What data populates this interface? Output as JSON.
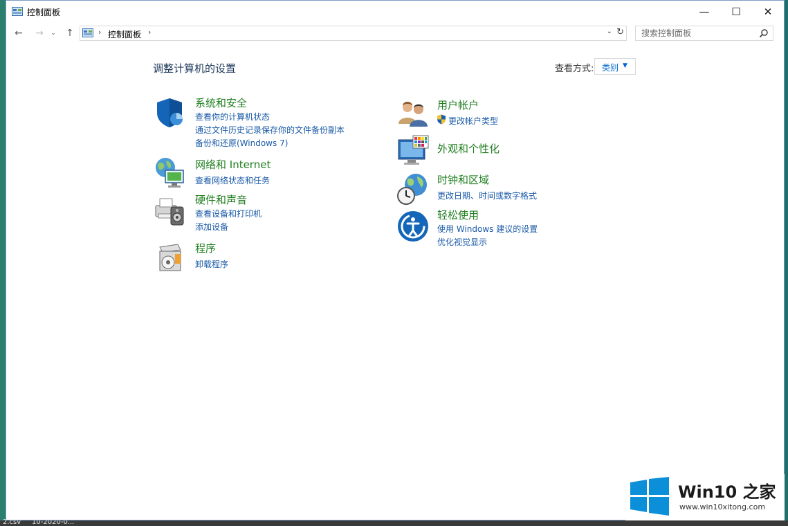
{
  "window": {
    "title": "控制面板",
    "min_glyph": "—",
    "max_glyph": "☐",
    "close_glyph": "✕"
  },
  "nav": {
    "back_glyph": "←",
    "forward_glyph": "→",
    "recent_glyph": "⌄",
    "up_glyph": "↑"
  },
  "address": {
    "crumb": "控制面板",
    "sep": "›",
    "dropdown_glyph": "⌄",
    "refresh_glyph": "↻"
  },
  "search": {
    "placeholder": "搜索控制面板"
  },
  "main": {
    "title": "调整计算机的设置",
    "view_by_label": "查看方式:",
    "view_by_value": "类别",
    "view_by_arrow": "▼"
  },
  "categories": {
    "system": {
      "title": "系统和安全",
      "links": [
        "查看你的计算机状态",
        "通过文件历史记录保存你的文件备份副本",
        "备份和还原(Windows 7)"
      ]
    },
    "network": {
      "title": "网络和 Internet",
      "links": [
        "查看网络状态和任务"
      ]
    },
    "hardware": {
      "title": "硬件和声音",
      "links": [
        "查看设备和打印机",
        "添加设备"
      ]
    },
    "programs": {
      "title": "程序",
      "links": [
        "卸载程序"
      ]
    },
    "user": {
      "title": "用户帐户",
      "links": [
        "更改帐户类型"
      ]
    },
    "appearance": {
      "title": "外观和个性化",
      "links": []
    },
    "clock": {
      "title": "时钟和区域",
      "links": [
        "更改日期、时间或数字格式"
      ]
    },
    "ease": {
      "title": "轻松使用",
      "links": [
        "使用 Windows 建议的设置",
        "优化视觉显示"
      ]
    }
  },
  "desktop": {
    "taskbar_text": "2.csv     10-2020-0..."
  },
  "watermark": {
    "title": "Win10 之家",
    "url": "www.win10xitong.com"
  },
  "colors": {
    "category_title": "#1e7d1e",
    "link": "#1a5aa8",
    "page_title": "#1e395b"
  }
}
